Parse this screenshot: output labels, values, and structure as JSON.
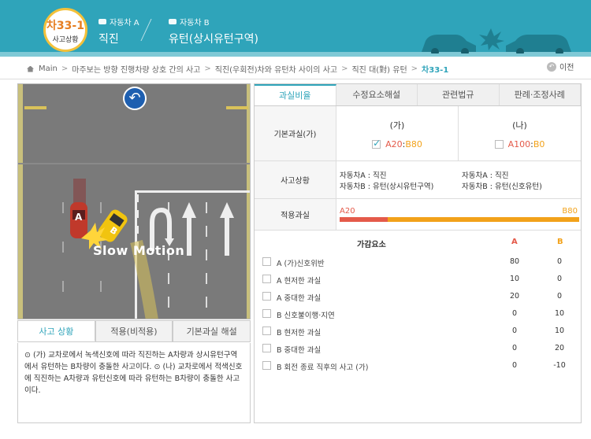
{
  "header": {
    "badge_code": "차33-1",
    "badge_sub": "사고상황",
    "car_a_label": "자동차 A",
    "car_a_value": "직진",
    "car_b_label": "자동차 B",
    "car_b_value": "유턴(상시유턴구역)"
  },
  "breadcrumb": {
    "items": [
      "Main",
      "마주보는 방향 진행차량 상호 간의 사고",
      "직진(우회전)차와 유턴차 사이의 사고",
      "직진 대(對) 유턴"
    ],
    "current": "차33-1"
  },
  "prev_label": "이전",
  "video": {
    "overlay_text": "Slow Motion",
    "car_a_tag": "A",
    "car_b_tag": "B"
  },
  "left_tabs": [
    {
      "label": "사고 상황",
      "active": true
    },
    {
      "label": "적용(비적용)",
      "active": false
    },
    {
      "label": "기본과실 해설",
      "active": false
    }
  ],
  "situation_text": "⊙ (가) 교차로에서 녹색신호에 따라 직진하는 A차량과 상시유턴구역에서 유턴하는 B차량이 충돌한 사고이다. ⊙ (나) 교차로에서 적색신호에 직진하는 A차량과 유턴신호에 따라 유턴하는 B차량이 충돌한 사고이다.",
  "right_tabs": [
    {
      "label": "과실비율",
      "active": true
    },
    {
      "label": "수정요소해설",
      "active": false
    },
    {
      "label": "관련법규",
      "active": false
    },
    {
      "label": "판례·조정사례",
      "active": false
    }
  ],
  "basic": {
    "label": "기본과실(가)",
    "opt_ga": {
      "head": "(가)",
      "a": "A20",
      "sep": ":",
      "b": "B80",
      "checked": true
    },
    "opt_na": {
      "head": "(나)",
      "a": "A100",
      "sep": ":",
      "b": "B0",
      "checked": false
    }
  },
  "situation": {
    "label": "사고상황",
    "ga_line1": "자동차A : 직진",
    "ga_line2": "자동차B : 유턴(상시유턴구역)",
    "na_line1": "자동차A : 직진",
    "na_line2": "자동차B : 유턴(신호유턴)"
  },
  "applied": {
    "label": "적용과실",
    "a_label": "A20",
    "b_label": "B80",
    "a_fraction": 0.2
  },
  "adjust": {
    "header": "가감요소",
    "col_a": "A",
    "col_b": "B",
    "rows": [
      {
        "name": "A (가)신호위반",
        "a": "80",
        "b": "0"
      },
      {
        "name": "A 현저한 과실",
        "a": "10",
        "b": "0"
      },
      {
        "name": "A 중대한 과실",
        "a": "20",
        "b": "0"
      },
      {
        "name": "B 신호불이행·지연",
        "a": "0",
        "b": "10"
      },
      {
        "name": "B 현저한 과실",
        "a": "0",
        "b": "10"
      },
      {
        "name": "B 중대한 과실",
        "a": "0",
        "b": "20"
      },
      {
        "name": "B 회전 종료 직후의 사고 (가)",
        "a": "0",
        "b": "-10"
      }
    ]
  },
  "colors": {
    "brand": "#2fa4ba",
    "car_a": "#e45a4a",
    "car_b": "#f2a21a"
  }
}
